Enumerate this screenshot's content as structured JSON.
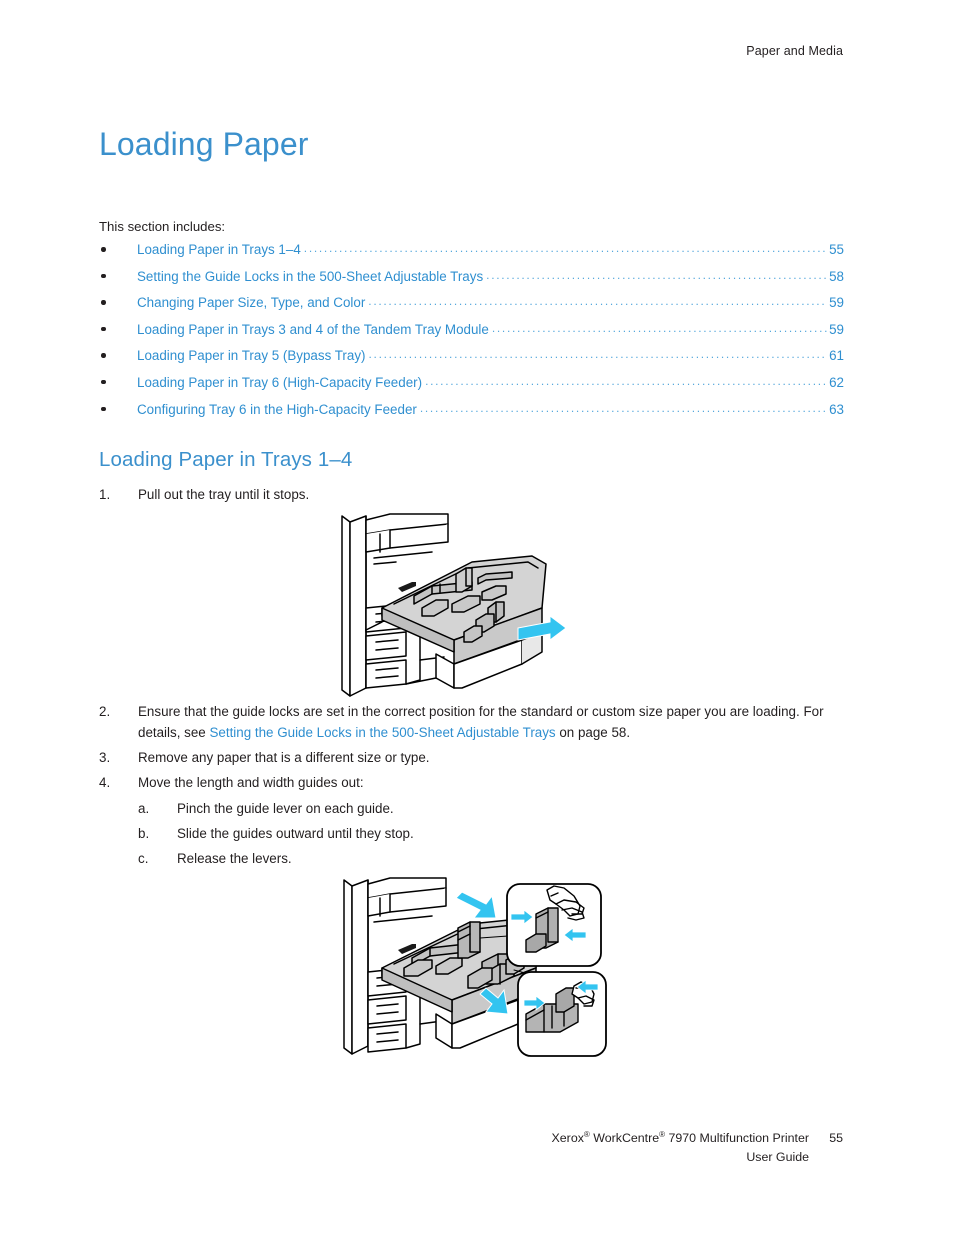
{
  "header": {
    "running_head": "Paper and Media"
  },
  "page_title": "Loading Paper",
  "intro": "This section includes:",
  "toc": {
    "items": [
      {
        "label": "Loading Paper in Trays 1–4",
        "page": "55"
      },
      {
        "label": "Setting the Guide Locks in the 500-Sheet Adjustable Trays",
        "page": "58"
      },
      {
        "label": "Changing Paper Size, Type, and Color",
        "page": "59"
      },
      {
        "label": "Loading Paper in Trays 3 and 4 of the Tandem Tray Module",
        "page": "59"
      },
      {
        "label": "Loading Paper in Tray 5 (Bypass Tray)",
        "page": "61"
      },
      {
        "label": "Loading Paper in Tray 6 (High-Capacity Feeder)",
        "page": "62"
      },
      {
        "label": "Configuring Tray 6 in the High-Capacity Feeder",
        "page": "63"
      }
    ],
    "leader": "...................................................................................................................................................................."
  },
  "section": {
    "heading": "Loading Paper in Trays 1–4",
    "step1": {
      "num": "1.",
      "text": "Pull out the tray until it stops."
    },
    "step2": {
      "num": "2.",
      "text_before": "Ensure that the guide locks are set in the correct position for the standard or custom size paper you are loading. For details, see ",
      "link": "Setting the Guide Locks in the 500-Sheet Adjustable Trays",
      "text_after": " on page 58."
    },
    "step3": {
      "num": "3.",
      "text": "Remove any paper that is a different size or type."
    },
    "step4": {
      "num": "4.",
      "text": "Move the length and width guides out:",
      "substeps": [
        {
          "num": "a.",
          "text": "Pinch the guide lever on each guide."
        },
        {
          "num": "b.",
          "text": "Slide the guides outward until they stop."
        },
        {
          "num": "c.",
          "text": "Release the levers."
        }
      ]
    }
  },
  "figures": {
    "figure1_name": "printer-tray-pull-out-illustration",
    "figure2_name": "printer-tray-guide-levers-illustration"
  },
  "footer": {
    "brand": "Xerox",
    "reg1": "®",
    "product": " WorkCentre",
    "reg2": "®",
    "model": " 7970 Multifunction Printer",
    "page_number": "55",
    "guide": "User Guide"
  },
  "colors": {
    "heading_blue": "#3b90cc",
    "link_blue": "#2f8fd0",
    "arrow_cyan": "#33c4f0",
    "text_black": "#231f20"
  }
}
